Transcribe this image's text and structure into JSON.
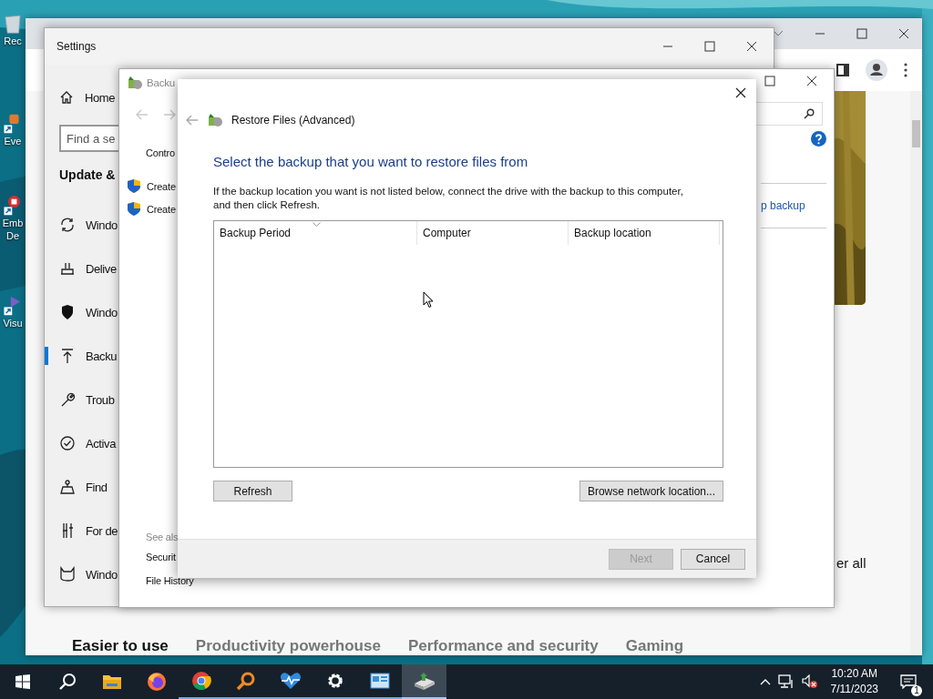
{
  "desktop_icons": [
    {
      "label": "Rec",
      "kind": "recycle"
    },
    {
      "label": "Eve",
      "kind": "shortcut"
    },
    {
      "label": "Emb De",
      "kind": "shortcut-red"
    },
    {
      "label": "Visu",
      "kind": "shortcut-purple"
    }
  ],
  "browser": {
    "headings": [
      "Easier to use",
      "Productivity powerhouse",
      "Performance and security",
      "Gaming"
    ],
    "partial_text": "er all"
  },
  "settings": {
    "title": "Settings",
    "home": "Home",
    "search_placeholder": "Find a se",
    "section": "Update &",
    "nav": [
      {
        "label": "Windo",
        "kind": "sync",
        "selected": false
      },
      {
        "label": "Delive",
        "kind": "delivery",
        "selected": false
      },
      {
        "label": "Windo",
        "kind": "shield",
        "selected": false
      },
      {
        "label": "Backu",
        "kind": "backup",
        "selected": true
      },
      {
        "label": "Troub",
        "kind": "wrench",
        "selected": false
      },
      {
        "label": "Activa",
        "kind": "check",
        "selected": false
      },
      {
        "label": "Find",
        "kind": "person",
        "selected": false
      },
      {
        "label": "For de",
        "kind": "tools",
        "selected": false
      },
      {
        "label": "Windo",
        "kind": "cat",
        "selected": false
      }
    ]
  },
  "backup_window": {
    "title": "Backu",
    "breadcrumb": "Contro",
    "tasks": [
      "Create",
      "Create"
    ],
    "see_also_label": "See als",
    "see_also": [
      "Securit",
      "File History"
    ],
    "link": "p backup"
  },
  "dialog": {
    "title": "Restore Files (Advanced)",
    "heading": "Select the backup that you want to restore files from",
    "instructions": "If the backup location you want is not listed below, connect the drive with the backup to this computer, and then click Refresh.",
    "columns": [
      {
        "label": "Backup Period",
        "sorted": true
      },
      {
        "label": "Computer",
        "sorted": false
      },
      {
        "label": "Backup location",
        "sorted": false
      }
    ],
    "refresh": "Refresh",
    "browse": "Browse network location...",
    "footer_buttons": [
      {
        "label": "Next",
        "disabled": true
      },
      {
        "label": "Cancel",
        "disabled": false
      }
    ]
  },
  "taskbar": {
    "items": [
      {
        "kind": "start",
        "running": false,
        "selected": false
      },
      {
        "kind": "search",
        "running": false,
        "selected": false
      },
      {
        "kind": "folder",
        "running": false,
        "selected": false
      },
      {
        "kind": "firefox",
        "running": false,
        "selected": false
      },
      {
        "kind": "chrome",
        "running": true,
        "selected": false
      },
      {
        "kind": "magnifier",
        "running": true,
        "selected": false
      },
      {
        "kind": "heart",
        "running": true,
        "selected": false
      },
      {
        "kind": "gear",
        "running": true,
        "selected": false
      },
      {
        "kind": "panel",
        "running": true,
        "selected": false
      },
      {
        "kind": "backup",
        "running": true,
        "selected": true
      }
    ],
    "time": "10:20 AM",
    "date": "7/11/2023",
    "notifications": "1"
  }
}
